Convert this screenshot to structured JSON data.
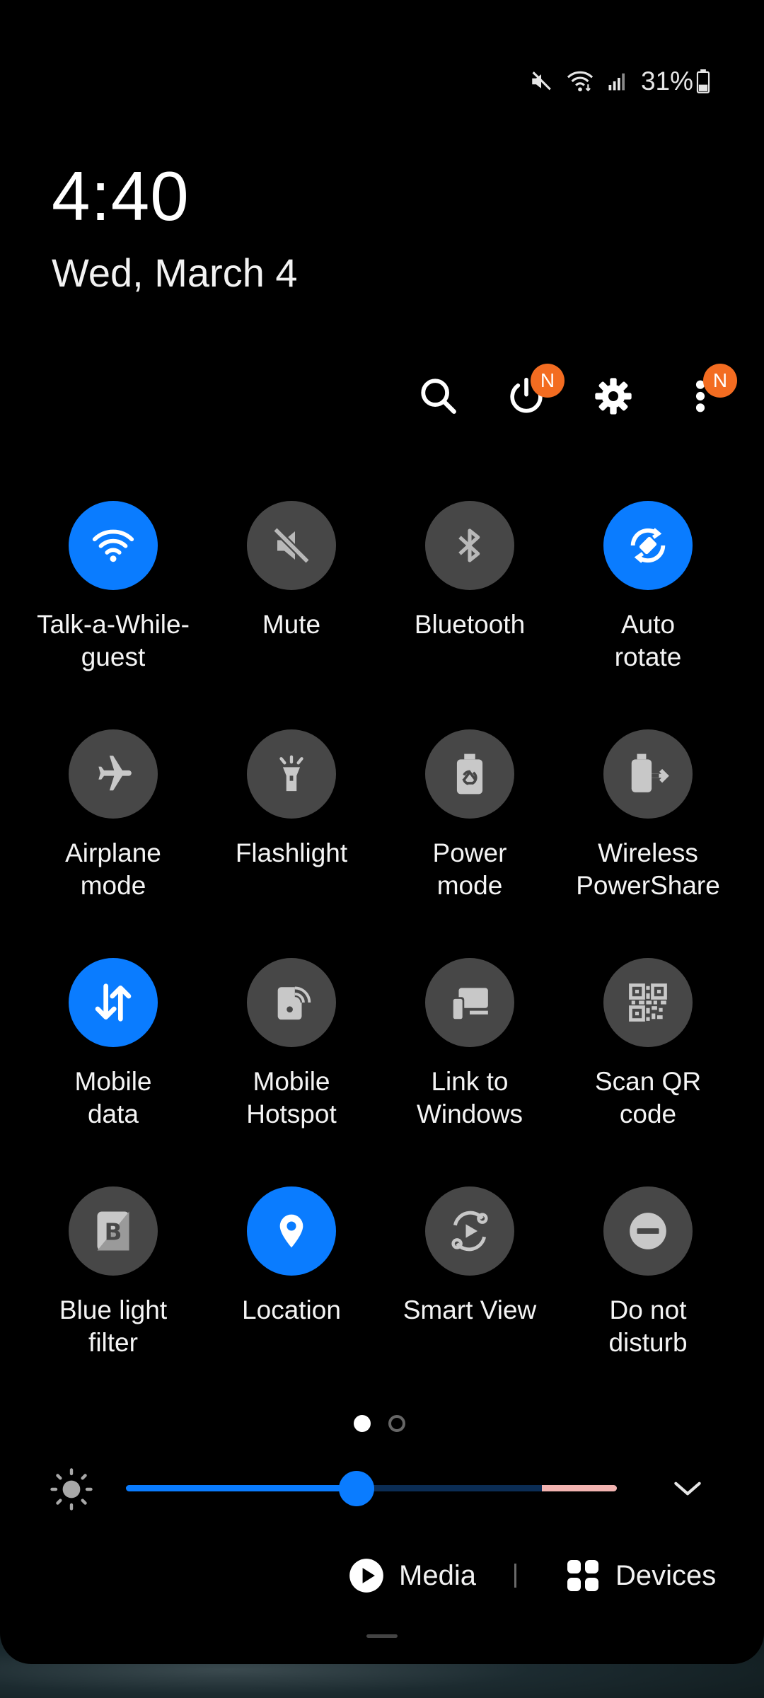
{
  "status_bar": {
    "battery": "31%"
  },
  "clock": {
    "time": "4:40",
    "date": "Wed, March 4"
  },
  "actions": {
    "power_badge": "N",
    "more_badge": "N"
  },
  "tiles": [
    {
      "label": "Talk-a-While-guest",
      "line1": "Talk-a-While-",
      "line2": "guest",
      "icon": "wifi-icon",
      "on": true
    },
    {
      "label": "Mute",
      "line1": "Mute",
      "line2": "",
      "icon": "mute-icon",
      "on": false
    },
    {
      "label": "Bluetooth",
      "line1": "Bluetooth",
      "line2": "",
      "icon": "bluetooth-icon",
      "on": false
    },
    {
      "label": "Auto rotate",
      "line1": "Auto",
      "line2": "rotate",
      "icon": "auto-rotate-icon",
      "on": true
    },
    {
      "label": "Airplane mode",
      "line1": "Airplane",
      "line2": "mode",
      "icon": "airplane-icon",
      "on": false
    },
    {
      "label": "Flashlight",
      "line1": "Flashlight",
      "line2": "",
      "icon": "flashlight-icon",
      "on": false
    },
    {
      "label": "Power mode",
      "line1": "Power",
      "line2": "mode",
      "icon": "power-mode-icon",
      "on": false
    },
    {
      "label": "Wireless PowerShare",
      "line1": "Wireless",
      "line2": "PowerShare",
      "icon": "wireless-powershare-icon",
      "on": false
    },
    {
      "label": "Mobile data",
      "line1": "Mobile",
      "line2": "data",
      "icon": "mobile-data-icon",
      "on": true
    },
    {
      "label": "Mobile Hotspot",
      "line1": "Mobile",
      "line2": "Hotspot",
      "icon": "hotspot-icon",
      "on": false
    },
    {
      "label": "Link to Windows",
      "line1": "Link to",
      "line2": "Windows",
      "icon": "link-to-windows-icon",
      "on": false
    },
    {
      "label": "Scan QR code",
      "line1": "Scan QR",
      "line2": "code",
      "icon": "qr-code-icon",
      "on": false
    },
    {
      "label": "Blue light filter",
      "line1": "Blue light",
      "line2": "filter",
      "icon": "blue-light-filter-icon",
      "on": false
    },
    {
      "label": "Location",
      "line1": "Location",
      "line2": "",
      "icon": "location-icon",
      "on": true
    },
    {
      "label": "Smart View",
      "line1": "Smart View",
      "line2": "",
      "icon": "smart-view-icon",
      "on": false
    },
    {
      "label": "Do not disturb",
      "line1": "Do not",
      "line2": "disturb",
      "icon": "do-not-disturb-icon",
      "on": false
    }
  ],
  "pages": {
    "count": 2,
    "current": 1
  },
  "brightness": {
    "level": 0.47
  },
  "footer": {
    "media_label": "Media",
    "devices_label": "Devices"
  },
  "colors": {
    "accent": "#0a7cff",
    "tile_off": "#474747",
    "badge": "#f36c21"
  }
}
